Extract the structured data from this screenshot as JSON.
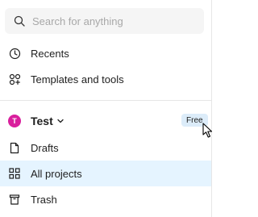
{
  "search": {
    "placeholder": "Search for anything",
    "icon": "search-icon"
  },
  "nav": [
    {
      "label": "Recents",
      "icon": "clock-icon"
    },
    {
      "label": "Templates and tools",
      "icon": "templates-icon"
    }
  ],
  "team": {
    "avatar_letter": "T",
    "name": "Test",
    "badge": "Free",
    "avatar_color": "#d91f9d"
  },
  "team_items": [
    {
      "label": "Drafts",
      "icon": "file-icon",
      "selected": false
    },
    {
      "label": "All projects",
      "icon": "grid-icon",
      "selected": true
    },
    {
      "label": "Trash",
      "icon": "trash-icon",
      "selected": false
    }
  ],
  "colors": {
    "selected_bg": "#e5f4ff",
    "badge_bg": "#dcecf9"
  }
}
